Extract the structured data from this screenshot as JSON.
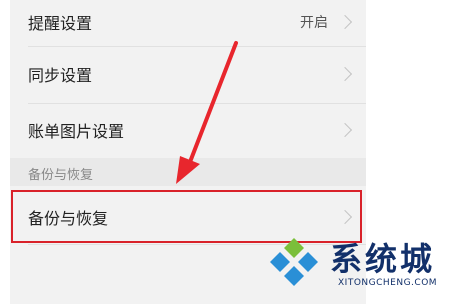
{
  "settings": {
    "items": [
      {
        "label": "提醒设置",
        "value": "开启"
      },
      {
        "label": "同步设置",
        "value": ""
      },
      {
        "label": "账单图片设置",
        "value": ""
      }
    ],
    "section_title": "备份与恢复",
    "highlighted_item": {
      "label": "备份与恢复"
    }
  },
  "annotation": {
    "arrow_color": "#e8262d",
    "highlight_color": "#d9222a"
  },
  "watermark": {
    "text": "系统城",
    "subtext": "XITONGCHENG.COM"
  }
}
